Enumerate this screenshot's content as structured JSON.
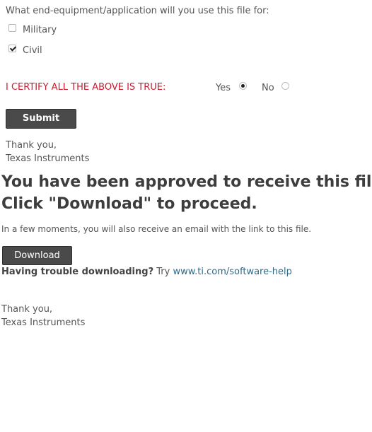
{
  "form": {
    "question": "What end-equipment/application will you use this file for:",
    "options": [
      {
        "label": "Military",
        "checked": false
      },
      {
        "label": "Civil",
        "checked": true
      }
    ],
    "certify_label": "I CERTIFY ALL THE ABOVE IS TRUE:",
    "certify_color": "#cc1a2e",
    "radio": {
      "yes_label": "Yes",
      "no_label": "No",
      "selected": "Yes"
    },
    "submit_label": "Submit",
    "thanks": "Thank you,",
    "signature": "Texas Instruments"
  },
  "result": {
    "heading_line1": "You have been approved to receive this file.",
    "heading_line2": "Click \"Download\" to proceed.",
    "email_note": "In a few moments, you will also receive an email with the link to this file.",
    "download_label": "Download",
    "trouble_bold": "Having trouble downloading?",
    "trouble_text": " Try ",
    "help_link": "www.ti.com/software-help",
    "thanks": "Thank you,",
    "signature": "Texas Instruments"
  },
  "colors": {
    "button_bg": "#4a4a4a",
    "link": "#2b6a8a"
  }
}
